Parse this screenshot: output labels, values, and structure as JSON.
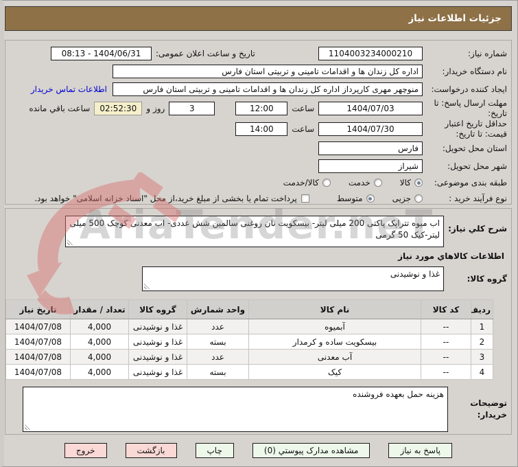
{
  "banner": {
    "title": "جزئیات اطلاعات نیاز"
  },
  "info": {
    "need_number": {
      "label": "شماره نیاز:",
      "value": "1104003234000210"
    },
    "announce": {
      "label": "تاریخ و ساعت اعلان عمومی:",
      "value": "1404/06/31 - 08:13"
    },
    "buyer_org": {
      "label": "نام دستگاه خریدار:",
      "value": "اداره کل زندان ها و اقدامات تامینی و تربیتی استان فارس"
    },
    "creator": {
      "label": "ایجاد کننده درخواست:",
      "value": "منوچهر مهری کارپرداز اداره کل زندان ها و اقدامات تامینی و تربیتی استان فارس",
      "contact_link": "اطلاعات تماس خریدار"
    },
    "deadline": {
      "label": "مهلت ارسال پاسخ: تا تاریخ:",
      "date": "1404/07/03",
      "hour_label": "ساعت",
      "time": "12:00",
      "days": "3",
      "days_label": "روز و",
      "countdown": "02:52:30",
      "countdown_label": "ساعت باقي مانده"
    },
    "price_validity": {
      "label": "حداقل تاریخ اعتبار قیمت: تا تاریخ:",
      "date": "1404/07/30",
      "hour_label": "ساعت",
      "time": "14:00"
    },
    "province": {
      "label": "استان محل تحویل:",
      "value": "فارس"
    },
    "city": {
      "label": "شهر محل تحویل:",
      "value": "شیراز"
    },
    "classification": {
      "label": "طبقه بندی موضوعی:",
      "options": [
        {
          "label": "کالا",
          "selected": true
        },
        {
          "label": "خدمت",
          "selected": false
        },
        {
          "label": "کالا/خدمت",
          "selected": false
        }
      ]
    },
    "process": {
      "label": "نوع فرآیند خرید :",
      "options": [
        {
          "label": "جزیی",
          "selected": false
        },
        {
          "label": "متوسط",
          "selected": true
        }
      ],
      "treasury_checkbox": "پرداخت تمام یا بخشی از مبلغ خرید،از محل \"اسناد خزانه اسلامی\" خواهد بود."
    }
  },
  "need_desc": {
    "label": "شرح کلي نیاز:",
    "value": "اب میوه تتراپک پاکتی 200 میلی لیتر- بیسکویت نان روغنی سالمین شش عددی- اب معدنی کوچک 500 میلی لیتر-کیک 50 گرمی"
  },
  "goods_section": {
    "title": "اطلاعات کالاهاي مورد نیاز",
    "group_label": "گروه کالا:",
    "group_value": "غذا و نوشیدنی"
  },
  "table": {
    "headers": [
      "ردیف",
      "کد کالا",
      "نام کالا",
      "واحد شمارش",
      "گروه کالا",
      "تعداد / مقدار",
      "تاریخ نیاز"
    ],
    "rows": [
      {
        "row": "1",
        "code": "--",
        "name": "آبمیوه",
        "unit": "عدد",
        "group": "غذا و نوشیدنی",
        "qty": "4,000",
        "date": "1404/07/08"
      },
      {
        "row": "2",
        "code": "--",
        "name": "بیسکویت ساده و کرمدار",
        "unit": "بسته",
        "group": "غذا و نوشیدنی",
        "qty": "4,000",
        "date": "1404/07/08"
      },
      {
        "row": "3",
        "code": "--",
        "name": "آب معدنی",
        "unit": "عدد",
        "group": "غذا و نوشیدنی",
        "qty": "4,000",
        "date": "1404/07/08"
      },
      {
        "row": "4",
        "code": "--",
        "name": "کیک",
        "unit": "بسته",
        "group": "غذا و نوشیدنی",
        "qty": "4,000",
        "date": "1404/07/08"
      }
    ]
  },
  "buyer_notes": {
    "label": "توضیحات خریدار:",
    "value": "هزینه حمل بعهده فروشنده"
  },
  "buttons": [
    {
      "label": "پاسخ به نیاز",
      "type": "green"
    },
    {
      "label": "مشاهده مدارک پیوستي (0)",
      "type": "green"
    },
    {
      "label": "چاپ",
      "type": "green"
    },
    {
      "label": "بازگشت",
      "type": "pink"
    },
    {
      "label": "خروج",
      "type": "pink"
    }
  ],
  "watermark": {
    "text": "AriaTender.neT"
  },
  "colors": {
    "banner_bg": "#8e7147",
    "page_bg": "#d7d4cf",
    "countdown_bg": "#f5f0cb",
    "link_blue": "#0000d0",
    "btn_green": "#eef8ea",
    "btn_pink": "#f9d8d5"
  }
}
